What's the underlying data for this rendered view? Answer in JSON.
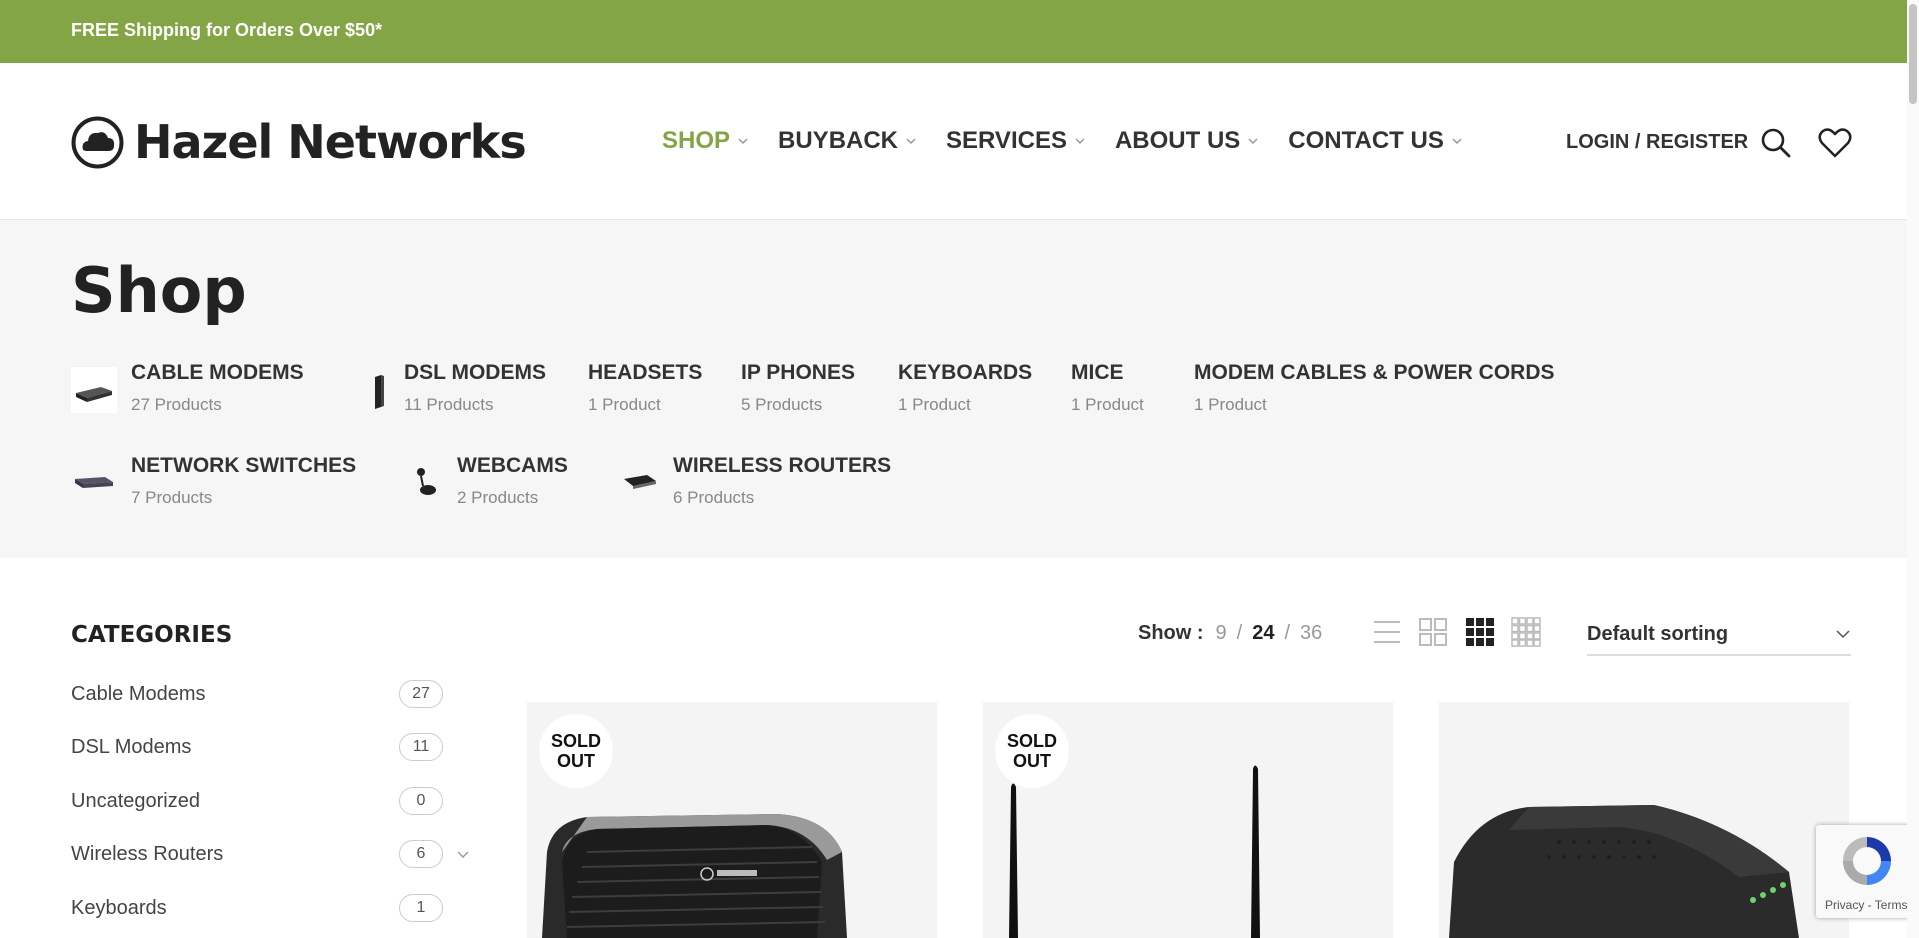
{
  "topbar": {
    "text": "FREE Shipping for Orders Over $50*"
  },
  "header": {
    "logo_text": "Hazel Networks",
    "nav": [
      {
        "label": "SHOP",
        "active": true
      },
      {
        "label": "BUYBACK",
        "active": false
      },
      {
        "label": "SERVICES",
        "active": false
      },
      {
        "label": "ABOUT US",
        "active": false
      },
      {
        "label": "CONTACT US",
        "active": false
      }
    ],
    "login_label": "LOGIN / REGISTER",
    "accent_color": "#84a545"
  },
  "shop": {
    "title": "Shop",
    "categories": [
      {
        "name": "CABLE MODEMS",
        "count": "27 Products",
        "icon": "cable-modem-thumb"
      },
      {
        "name": "DSL MODEMS",
        "count": "11 Products",
        "icon": "dsl-modem-thumb"
      },
      {
        "name": "HEADSETS",
        "count": "1 Product"
      },
      {
        "name": "IP PHONES",
        "count": "5 Products"
      },
      {
        "name": "KEYBOARDS",
        "count": "1 Product"
      },
      {
        "name": "MICE",
        "count": "1 Product"
      },
      {
        "name": "MODEM CABLES & POWER CORDS",
        "count": "1 Product"
      },
      {
        "name": "NETWORK SWITCHES",
        "count": "7 Products",
        "icon": "network-switch-thumb"
      },
      {
        "name": "WEBCAMS",
        "count": "2 Products",
        "icon": "webcam-thumb"
      },
      {
        "name": "WIRELESS ROUTERS",
        "count": "6 Products",
        "icon": "wireless-router-thumb"
      }
    ]
  },
  "sidebar": {
    "title": "CATEGORIES",
    "items": [
      {
        "label": "Cable Modems",
        "count": "27"
      },
      {
        "label": "DSL Modems",
        "count": "11"
      },
      {
        "label": "Uncategorized",
        "count": "0"
      },
      {
        "label": "Wireless Routers",
        "count": "6",
        "expandable": true
      },
      {
        "label": "Keyboards",
        "count": "1"
      }
    ]
  },
  "toolbar": {
    "show_label": "Show :",
    "show_options": [
      "9",
      "24",
      "36"
    ],
    "show_selected": "24",
    "separator": "/",
    "sorting_label": "Default sorting",
    "view_modes": [
      "list-view-icon",
      "grid-2-icon",
      "grid-3-icon",
      "grid-4-icon"
    ]
  },
  "products": [
    {
      "badge_line1": "SOLD",
      "badge_line2": "OUT",
      "image": "centurylink-modem-image"
    },
    {
      "badge_line1": "SOLD",
      "badge_line2": "OUT",
      "image": "dual-antenna-router-image"
    },
    {
      "image": "black-cable-modem-image"
    }
  ],
  "recaptcha": {
    "links": "Privacy - Terms"
  }
}
